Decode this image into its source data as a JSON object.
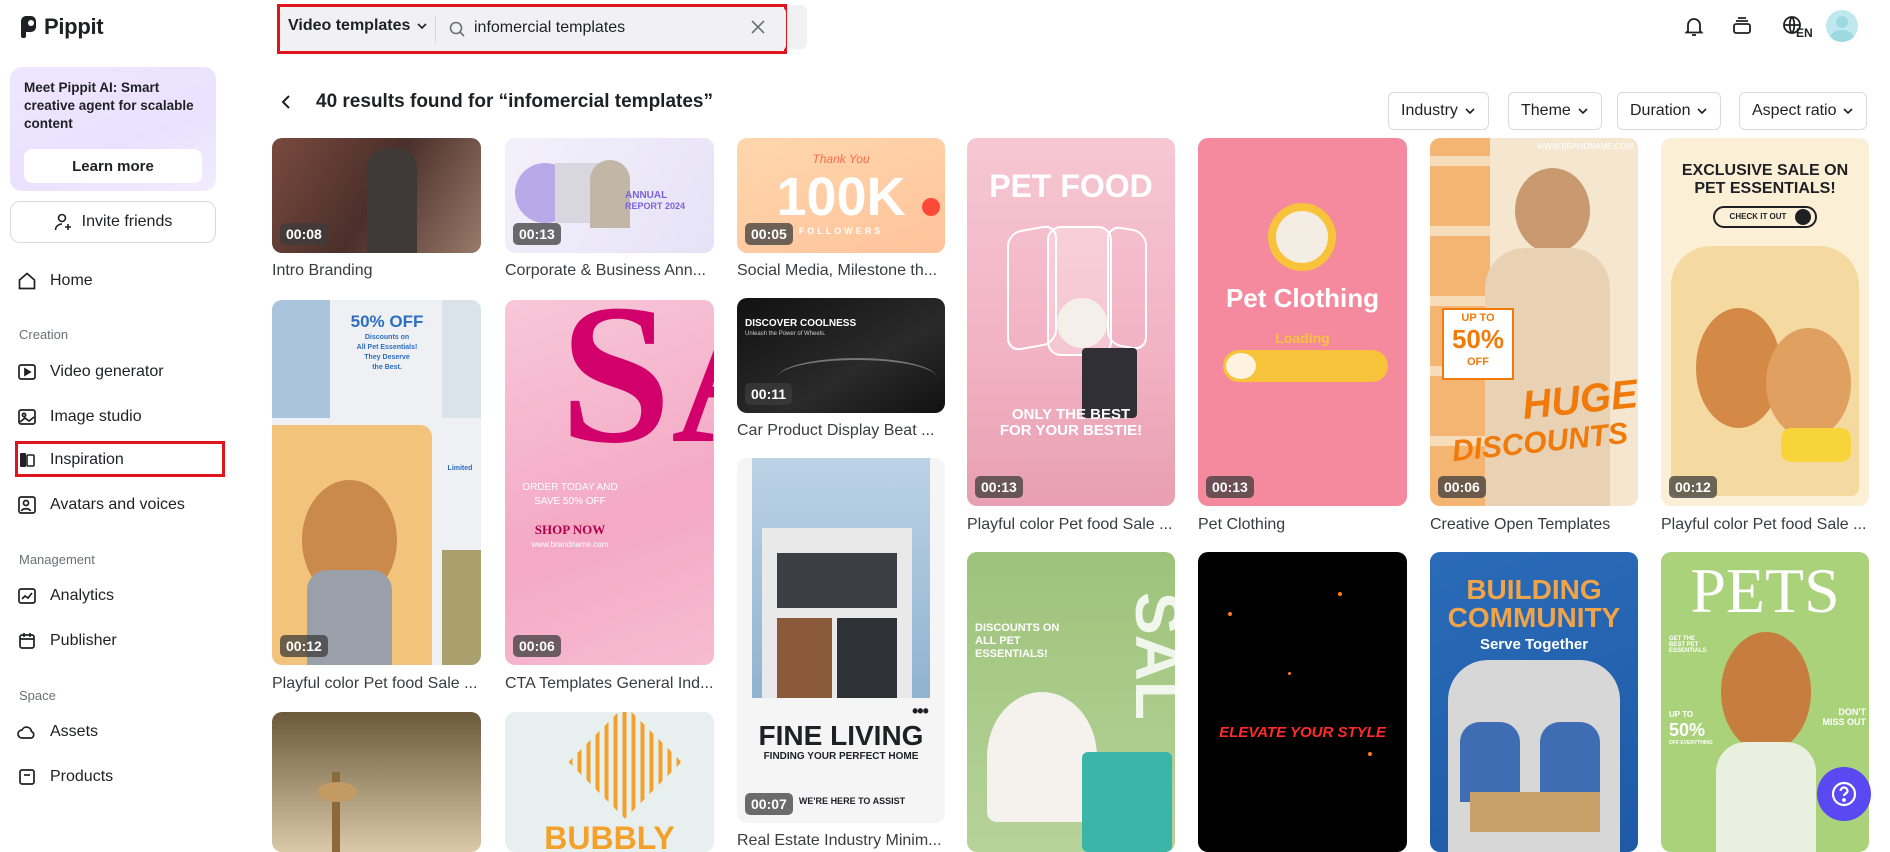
{
  "app": {
    "logo_text": "Pippit"
  },
  "sidebar": {
    "promo": {
      "text": "Meet Pippit AI: Smart creative agent for scalable content",
      "button": "Learn more"
    },
    "invite": "Invite friends",
    "home": "Home",
    "sections": {
      "creation": "Creation",
      "management": "Management",
      "space": "Space"
    },
    "creation_items": [
      "Video generator",
      "Image studio",
      "Inspiration",
      "Avatars and voices"
    ],
    "management_items": [
      "Analytics",
      "Publisher"
    ],
    "space_items": [
      "Assets",
      "Products"
    ]
  },
  "search": {
    "type": "Video templates",
    "value": "infomercial templates"
  },
  "topbar": {
    "lang": "EN"
  },
  "results": {
    "title": "40 results found for “infomercial templates”",
    "filters": [
      "Industry",
      "Theme",
      "Duration",
      "Aspect ratio"
    ]
  },
  "cards": [
    {
      "caption": "Intro Branding",
      "duration": "00:08"
    },
    {
      "caption": "Corporate & Business Ann...",
      "duration": "00:13",
      "text": [
        "ANNUAL",
        "REPORT 2024"
      ]
    },
    {
      "caption": "Social Media, Milestone th...",
      "duration": "00:05",
      "text": [
        "Thank You",
        "100K",
        "FOLLOWERS"
      ]
    },
    {
      "caption": "Playful color Pet food Sale ...",
      "duration": "00:13",
      "text": [
        "PET FOOD",
        "ONLY THE BEST",
        "FOR YOUR BESTIE!"
      ]
    },
    {
      "caption": "Pet Clothing",
      "duration": "00:13",
      "text": [
        "Pet Clothing",
        "Loading"
      ]
    },
    {
      "caption": "Creative Open Templates",
      "duration": "00:06",
      "text": [
        "WWW.BRANDNAME.COM",
        "UP TO",
        "50%",
        "OFF",
        "HUGE",
        "DISCOUNTS"
      ]
    },
    {
      "caption": "Playful color Pet food Sale ...",
      "duration": "00:12",
      "text": [
        "EXCLUSIVE SALE ON",
        "PET ESSENTIALS!",
        "CHECK IT OUT"
      ]
    },
    {
      "caption": "Playful color Pet food Sale ...",
      "duration": "00:12",
      "text": [
        "50% OFF",
        "Discounts on",
        "All Pet Essentials!",
        "They Deserve",
        "the Best.",
        "Limited"
      ]
    },
    {
      "caption": "CTA Templates General Ind...",
      "duration": "00:06",
      "text": [
        "SALE",
        "ORDER TODAY AND",
        "SAVE 50% OFF",
        "SHOP NOW",
        "www.brandname.com"
      ]
    },
    {
      "caption": "Car Product Display Beat ...",
      "duration": "00:11",
      "text": [
        "DISCOVER COOLNESS",
        "Unleash the Power of Wheels."
      ]
    },
    {
      "caption": "Real Estate Industry Minim...",
      "duration": "00:07",
      "text": [
        "FINE LIVING",
        "FINDING YOUR PERFECT HOME",
        "WE'RE HERE TO ASSIST"
      ]
    },
    {
      "caption": "",
      "duration": "",
      "text": [
        "DISCOUNTS ON",
        "ALL PET",
        "ESSENTIALS!",
        "SAL"
      ]
    },
    {
      "caption": "",
      "duration": "",
      "text": [
        "ELEVATE YOUR STYLE"
      ]
    },
    {
      "caption": "",
      "duration": "",
      "text": [
        "BUILDING",
        "COMMUNITY",
        "Serve Together"
      ]
    },
    {
      "caption": "",
      "duration": "",
      "text": [
        "PETS",
        "GET THE BEST PET ESSENTIALS",
        "UP TO",
        "50%",
        "OFF EVERYTHING",
        "DON'T MISS OUT"
      ]
    },
    {
      "caption": "",
      "duration": ""
    },
    {
      "caption": "",
      "duration": "",
      "text": [
        "BUBBLY"
      ]
    }
  ],
  "colors": {
    "accent": "#5a49f2",
    "highlight": "#e0141e",
    "promo_bg": "#ece4ff"
  }
}
